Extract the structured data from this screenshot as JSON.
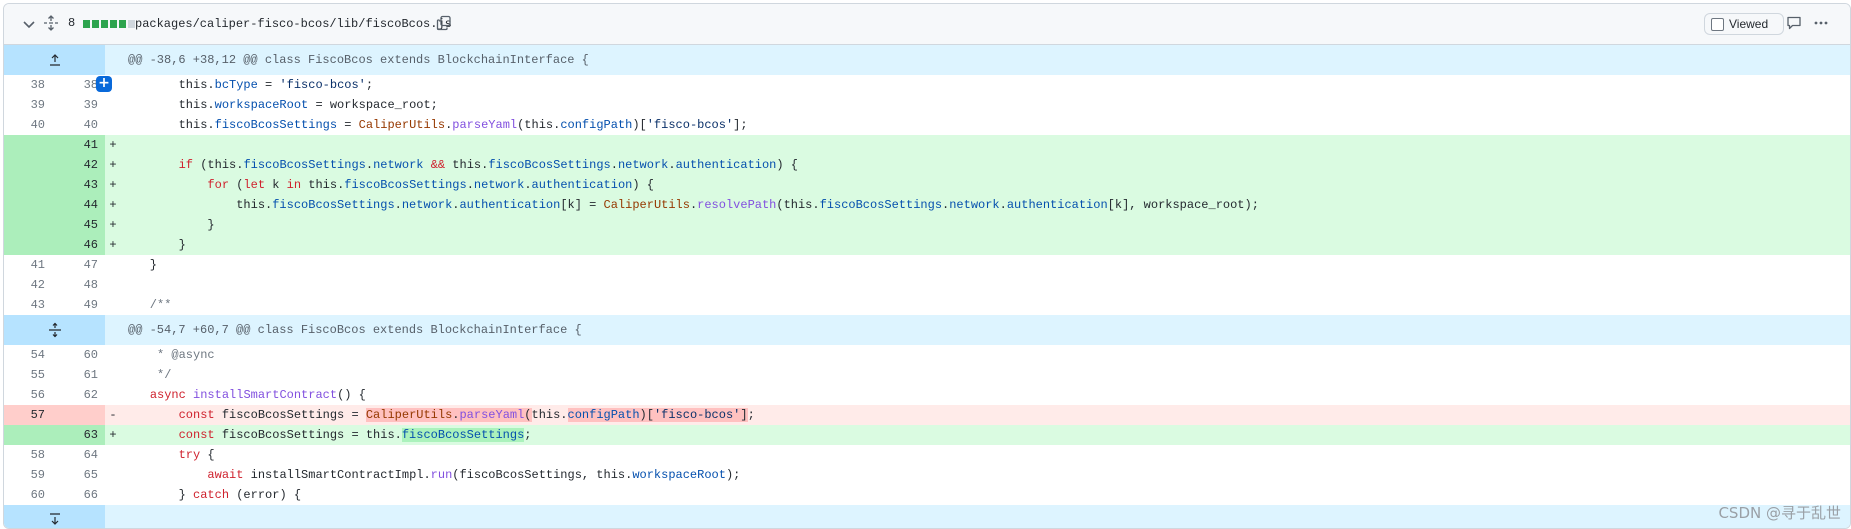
{
  "file": {
    "additions_count": "8",
    "diffstat": [
      "add",
      "add",
      "add",
      "add",
      "add",
      "neutral"
    ],
    "path": "packages/caliper-fisco-bcos/lib/fiscoBcos.js",
    "viewed_label": "Viewed",
    "viewed_checked": false
  },
  "colors": {
    "add": "#2da44e",
    "neutral": "#d0d7de",
    "accent": "#0969da"
  },
  "hunks": {
    "h1": "@@ -38,6 +38,12 @@ class FiscoBcos extends BlockchainInterface {",
    "h2": "@@ -54,7 +60,7 @@ class FiscoBcos extends BlockchainInterface {"
  },
  "lines": [
    {
      "o": "38",
      "n": "38",
      "m": "",
      "code": "        this.bcType = 'fisco-bcos';"
    },
    {
      "o": "39",
      "n": "39",
      "m": "",
      "code": "        this.workspaceRoot = workspace_root;"
    },
    {
      "o": "40",
      "n": "40",
      "m": "",
      "code": "        this.fiscoBcosSettings = CaliperUtils.parseYaml(this.configPath)['fisco-bcos'];"
    },
    {
      "o": "",
      "n": "41",
      "m": "+",
      "code": ""
    },
    {
      "o": "",
      "n": "42",
      "m": "+",
      "code": "        if (this.fiscoBcosSettings.network && this.fiscoBcosSettings.network.authentication) {"
    },
    {
      "o": "",
      "n": "43",
      "m": "+",
      "code": "            for (let k in this.fiscoBcosSettings.network.authentication) {"
    },
    {
      "o": "",
      "n": "44",
      "m": "+",
      "code": "                this.fiscoBcosSettings.network.authentication[k] = CaliperUtils.resolvePath(this.fiscoBcosSettings.network.authentication[k], workspace_root);"
    },
    {
      "o": "",
      "n": "45",
      "m": "+",
      "code": "            }"
    },
    {
      "o": "",
      "n": "46",
      "m": "+",
      "code": "        }"
    },
    {
      "o": "41",
      "n": "47",
      "m": "",
      "code": "    }"
    },
    {
      "o": "42",
      "n": "48",
      "m": "",
      "code": ""
    },
    {
      "o": "43",
      "n": "49",
      "m": "",
      "code": "    /**"
    },
    {
      "o": "54",
      "n": "60",
      "m": "",
      "code": "     * @async"
    },
    {
      "o": "55",
      "n": "61",
      "m": "",
      "code": "     */"
    },
    {
      "o": "56",
      "n": "62",
      "m": "",
      "code": "    async installSmartContract() {"
    },
    {
      "o": "57",
      "n": "",
      "m": "-",
      "code": "        const fiscoBcosSettings = CaliperUtils.parseYaml(this.configPath)['fisco-bcos'];"
    },
    {
      "o": "",
      "n": "63",
      "m": "+",
      "code": "        const fiscoBcosSettings = this.fiscoBcosSettings;"
    },
    {
      "o": "58",
      "n": "64",
      "m": "",
      "code": "        try {"
    },
    {
      "o": "59",
      "n": "65",
      "m": "",
      "code": "            await installSmartContractImpl.run(fiscoBcosSettings, this.workspaceRoot);"
    },
    {
      "o": "60",
      "n": "66",
      "m": "",
      "code": "        } catch (error) {"
    }
  ],
  "watermark": "CSDN @寻于乱世"
}
